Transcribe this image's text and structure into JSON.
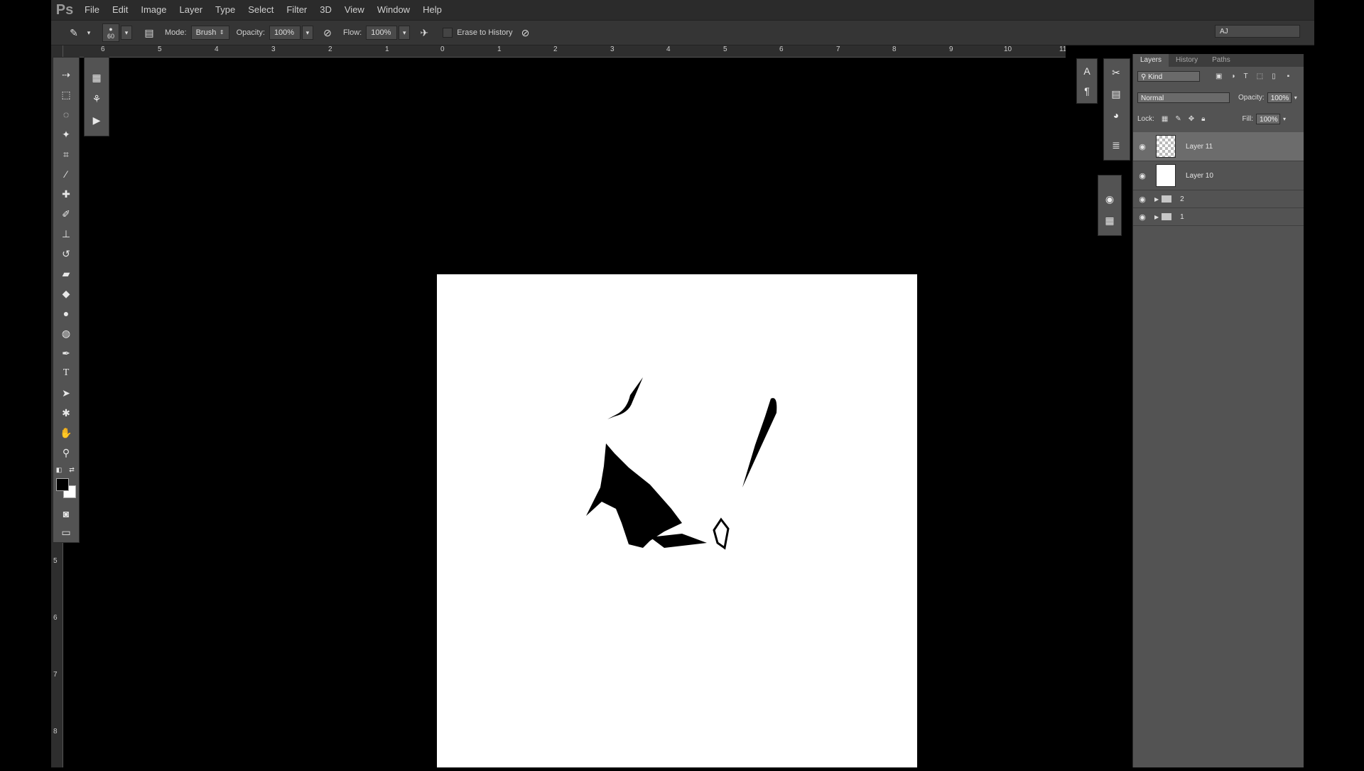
{
  "app": {
    "logo": "Ps"
  },
  "menubar": {
    "items": [
      "File",
      "Edit",
      "Image",
      "Layer",
      "Type",
      "Select",
      "Filter",
      "3D",
      "View",
      "Window",
      "Help"
    ]
  },
  "options": {
    "brush_size": "60",
    "mode_label": "Mode:",
    "mode_value": "Brush",
    "opacity_label": "Opacity:",
    "opacity_value": "100%",
    "flow_label": "Flow:",
    "flow_value": "100%",
    "erase_history_label": "Erase to History",
    "workspace": "AJ"
  },
  "rulers": {
    "top_labels": [
      "6",
      "5",
      "4",
      "3",
      "2",
      "1",
      "0",
      "1",
      "2",
      "3",
      "4",
      "5",
      "6",
      "7",
      "8",
      "9",
      "10",
      "11"
    ],
    "left_labels": [
      "5",
      "6",
      "7",
      "8"
    ]
  },
  "layers_panel": {
    "tabs": [
      "Layers",
      "History",
      "Paths"
    ],
    "active_tab": "Layers",
    "filter_value": "Kind",
    "blend_mode": "Normal",
    "opacity_label": "Opacity:",
    "opacity_value": "100%",
    "lock_label": "Lock:",
    "fill_label": "Fill:",
    "fill_value": "100%",
    "layers": [
      {
        "name": "Layer 11",
        "kind": "layer",
        "selected": true,
        "thumb": "checker"
      },
      {
        "name": "Layer 10",
        "kind": "layer",
        "selected": false,
        "thumb": "white"
      },
      {
        "name": "2",
        "kind": "group",
        "selected": false
      },
      {
        "name": "1",
        "kind": "group",
        "selected": false
      }
    ]
  },
  "colors": {
    "chrome": "#535353",
    "menubar": "#2b2b2b",
    "workspace": "#000000",
    "canvas": "#ffffff",
    "selected_layer": "#6c6c6c"
  }
}
